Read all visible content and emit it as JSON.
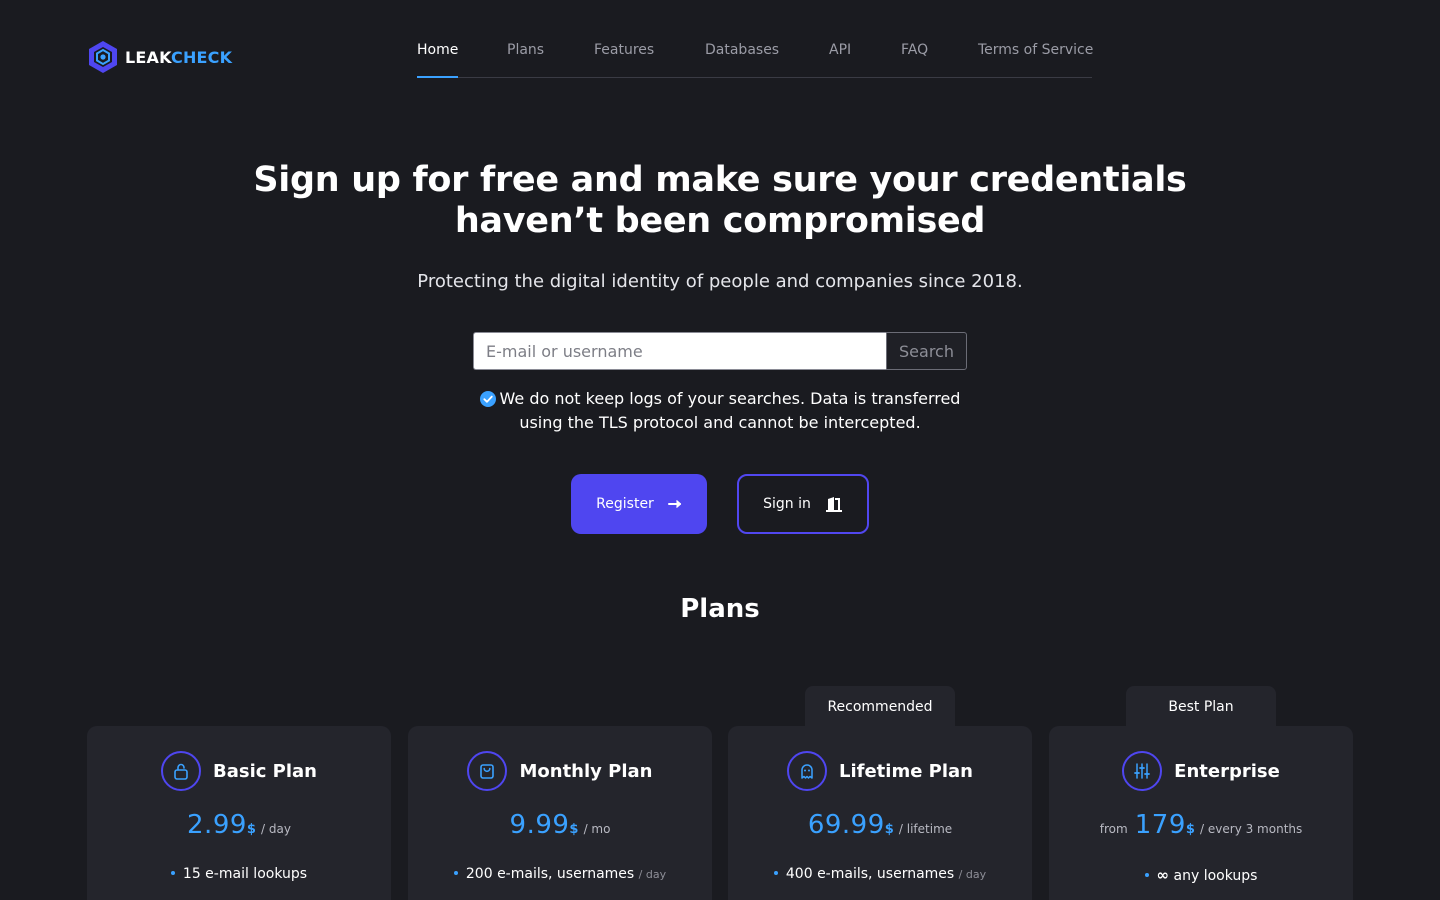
{
  "brand": {
    "name_part1": "LEAK",
    "name_part2": "CHECK",
    "accent": "#3aa1ff",
    "primary": "#4f46f0"
  },
  "nav": {
    "items": [
      {
        "label": "Home",
        "active": true
      },
      {
        "label": "Plans"
      },
      {
        "label": "Features"
      },
      {
        "label": "Databases"
      },
      {
        "label": "API"
      },
      {
        "label": "FAQ"
      },
      {
        "label": "Terms of Service"
      }
    ]
  },
  "hero": {
    "title_line1": "Sign up for free and make sure your credentials",
    "title_line2": "haven’t been compromised",
    "subtitle": "Protecting the digital identity of people and companies since 2018.",
    "search_placeholder": "E-mail or username",
    "search_button": "Search",
    "privacy_line1": "We do not keep logs of your searches. Data is transferred",
    "privacy_line2": "using the TLS protocol and cannot be intercepted.",
    "register_label": "Register",
    "signin_label": "Sign in"
  },
  "plans": {
    "title": "Plans",
    "tags": {
      "recommended": "Recommended",
      "best": "Best Plan"
    },
    "items": [
      {
        "name": "Basic Plan",
        "icon": "lock-icon",
        "price": "2.99",
        "currency": "$",
        "period": "/ day",
        "feature": "15 e-mail lookups",
        "feature_unit": ""
      },
      {
        "name": "Monthly Plan",
        "icon": "shopping-bag-icon",
        "price": "9.99",
        "currency": "$",
        "period": "/ mo",
        "feature": "200 e-mails, usernames",
        "feature_unit": "/ day"
      },
      {
        "name": "Lifetime Plan",
        "icon": "ghost-icon",
        "price": "69.99",
        "currency": "$",
        "period": "/ lifetime",
        "feature": "400 e-mails, usernames",
        "feature_unit": "/ day"
      },
      {
        "name": "Enterprise",
        "icon": "sliders-icon",
        "from": "from",
        "price": "179",
        "currency": "$",
        "period": "/ every 3 months",
        "feature_symbol": "∞",
        "feature": "any lookups",
        "feature_unit": ""
      }
    ]
  }
}
